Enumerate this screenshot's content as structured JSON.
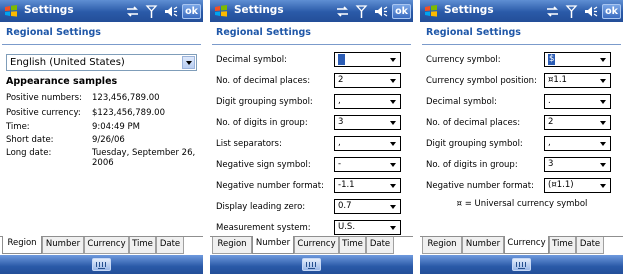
{
  "screens": [
    {
      "title": "Settings",
      "section_title": "Regional Settings",
      "locale_combo": {
        "value": "English (United States)"
      },
      "samples_heading": "Appearance samples",
      "samples": [
        {
          "label": "Positive numbers:",
          "value": "123,456,789.00"
        },
        {
          "label": "Positive currency:",
          "value": "$123,456,789.00"
        },
        {
          "label": "Time:",
          "value": "9:04:49 PM"
        },
        {
          "label": "Short date:",
          "value": "9/26/06"
        },
        {
          "label": "Long date:",
          "value": "Tuesday, September 26, 2006"
        }
      ],
      "tabs": [
        {
          "label": "Region",
          "active": true
        },
        {
          "label": "Number",
          "active": false
        },
        {
          "label": "Currency",
          "active": false
        },
        {
          "label": "Time",
          "active": false
        },
        {
          "label": "Date",
          "active": false
        }
      ]
    },
    {
      "title": "Settings",
      "section_title": "Regional Settings",
      "fields": [
        {
          "label": "Decimal symbol:",
          "value": "."
        },
        {
          "label": "No. of decimal places:",
          "value": "2"
        },
        {
          "label": "Digit grouping symbol:",
          "value": ","
        },
        {
          "label": "No. of digits in group:",
          "value": "3"
        },
        {
          "label": "List separators:",
          "value": ","
        },
        {
          "label": "Negative sign symbol:",
          "value": "-"
        },
        {
          "label": "Negative number format:",
          "value": "-1.1"
        },
        {
          "label": "Display leading zero:",
          "value": "0.7"
        },
        {
          "label": "Measurement system:",
          "value": "U.S."
        }
      ],
      "tabs": [
        {
          "label": "Region",
          "active": false
        },
        {
          "label": "Number",
          "active": true
        },
        {
          "label": "Currency",
          "active": false
        },
        {
          "label": "Time",
          "active": false
        },
        {
          "label": "Date",
          "active": false
        }
      ]
    },
    {
      "title": "Settings",
      "section_title": "Regional Settings",
      "fields": [
        {
          "label": "Currency symbol:",
          "value": "$"
        },
        {
          "label": "Currency symbol position:",
          "value": "¤1.1"
        },
        {
          "label": "Decimal symbol:",
          "value": "."
        },
        {
          "label": "No. of decimal places:",
          "value": "2"
        },
        {
          "label": "Digit grouping symbol:",
          "value": ","
        },
        {
          "label": "No. of digits in group:",
          "value": "3"
        },
        {
          "label": "Negative number format:",
          "value": "(¤1.1)"
        }
      ],
      "note": "¤ = Universal currency symbol",
      "tabs": [
        {
          "label": "Region",
          "active": false
        },
        {
          "label": "Number",
          "active": false
        },
        {
          "label": "Currency",
          "active": true
        },
        {
          "label": "Time",
          "active": false
        },
        {
          "label": "Date",
          "active": false
        }
      ]
    }
  ],
  "titlebar_ok_label": "ok",
  "icons": {
    "start": "windows-flag-icon",
    "connectivity": "connectivity-icon",
    "signal": "signal-icon",
    "volume": "volume-icon",
    "keyboard": "keyboard-icon"
  },
  "colors": {
    "titlebar": "#2a5aa8",
    "section_title": "#1f57a8",
    "selection": "#2b5cb4"
  }
}
